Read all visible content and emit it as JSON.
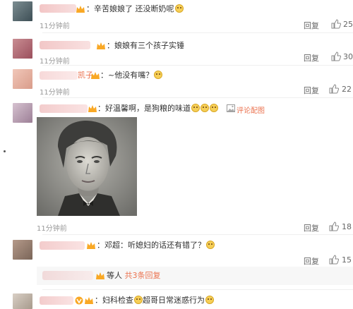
{
  "comments": [
    {
      "text": "：辛苦娘娘了 还没断奶呢",
      "time": "11分钟前",
      "reply_label": "回复",
      "likes": "25"
    },
    {
      "text": "：娘娘有三个孩子实锤",
      "time": "11分钟前",
      "reply_label": "回复",
      "likes": "30"
    },
    {
      "name_tail": "凯子",
      "text": "：~他没有嘴？",
      "time": "11分钟前",
      "reply_label": "回复",
      "likes": "22"
    },
    {
      "text": "：好温馨啊，是狗粮的味道",
      "tool_label": "评论配图",
      "time": "11分钟前",
      "reply_label": "回复",
      "likes": "18"
    },
    {
      "text": "：邓超：听媳妇的话还有错了？",
      "reply_label": "回复",
      "likes": "15"
    },
    {
      "text": "：妇科检查",
      "text2": "超哥日常迷惑行为"
    }
  ],
  "sub_reply": {
    "text": "等人",
    "link": "共3条回复"
  },
  "icons": [
    "vip-badge-icon",
    "emoji-icon",
    "thumb-up-icon",
    "image-icon"
  ],
  "colors": {
    "link": "#eb7350",
    "vip": "#f9a825",
    "muted": "#999999"
  }
}
